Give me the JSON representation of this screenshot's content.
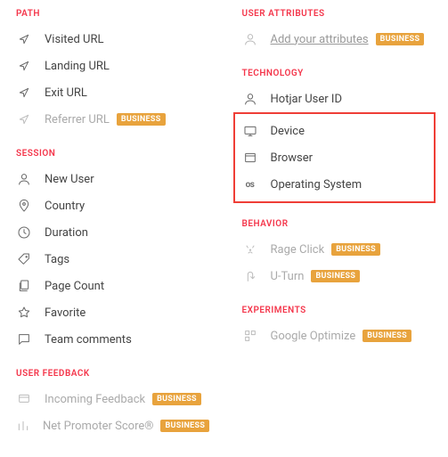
{
  "badge_business": "BUSINESS",
  "left": {
    "path": {
      "header": "PATH",
      "visited_url": "Visited URL",
      "landing_url": "Landing URL",
      "exit_url": "Exit URL",
      "referrer_url": "Referrer URL"
    },
    "session": {
      "header": "SESSION",
      "new_user": "New User",
      "country": "Country",
      "duration": "Duration",
      "tags": "Tags",
      "page_count": "Page Count",
      "favorite": "Favorite",
      "team_comments": "Team comments"
    },
    "user_feedback": {
      "header": "USER FEEDBACK",
      "incoming_feedback": "Incoming Feedback",
      "nps": "Net Promoter Score®"
    }
  },
  "right": {
    "user_attributes": {
      "header": "USER ATTRIBUTES",
      "add_link": "Add your attributes"
    },
    "technology": {
      "header": "TECHNOLOGY",
      "hotjar_user_id": "Hotjar User ID",
      "device": "Device",
      "browser": "Browser",
      "operating_system": "Operating System"
    },
    "behavior": {
      "header": "BEHAVIOR",
      "rage_click": "Rage Click",
      "u_turn": "U-Turn"
    },
    "experiments": {
      "header": "EXPERIMENTS",
      "google_optimize": "Google Optimize"
    }
  }
}
